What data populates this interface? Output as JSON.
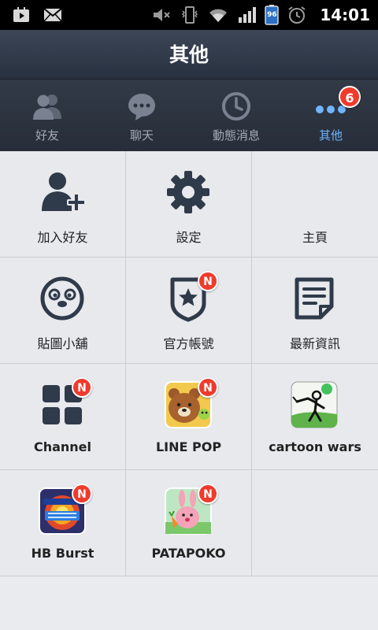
{
  "status_bar": {
    "time": "14:01",
    "battery_level": "96",
    "icons": [
      "play-store-icon",
      "mail-icon",
      "mute-icon",
      "vibrate-icon",
      "wifi-icon",
      "signal-icon",
      "battery-icon",
      "alarm-icon"
    ]
  },
  "header": {
    "title": "其他"
  },
  "tabs": [
    {
      "label": "好友",
      "icon": "friends-icon",
      "active": false
    },
    {
      "label": "聊天",
      "icon": "chat-icon",
      "active": false
    },
    {
      "label": "動態消息",
      "icon": "clock-icon",
      "active": false
    },
    {
      "label": "其他",
      "icon": "more-icon",
      "active": true,
      "badge": "6"
    }
  ],
  "grid": {
    "items": [
      {
        "label": "加入好友",
        "icon": "add-friend-icon"
      },
      {
        "label": "設定",
        "icon": "gear-icon"
      },
      {
        "label": "主頁",
        "icon": "home-icon"
      },
      {
        "label": "貼圖小舖",
        "icon": "sticker-shop-icon"
      },
      {
        "label": "官方帳號",
        "icon": "official-account-icon",
        "badge": "N"
      },
      {
        "label": "最新資訊",
        "icon": "news-icon"
      },
      {
        "label": "Channel",
        "icon": "channel-icon",
        "badge": "N"
      },
      {
        "label": "LINE POP",
        "icon": "line-pop-icon",
        "badge": "N"
      },
      {
        "label": "cartoon wars",
        "icon": "cartoon-wars-icon"
      },
      {
        "label": "HB Burst",
        "icon": "hb-burst-icon",
        "badge": "N"
      },
      {
        "label": "PATAPOKO",
        "icon": "patapoko-icon",
        "badge": "N"
      }
    ]
  },
  "colors": {
    "tab_active": "#6fb5ff",
    "badge_red": "#ef3b2c",
    "icon_dark": "#2f3a4a"
  }
}
